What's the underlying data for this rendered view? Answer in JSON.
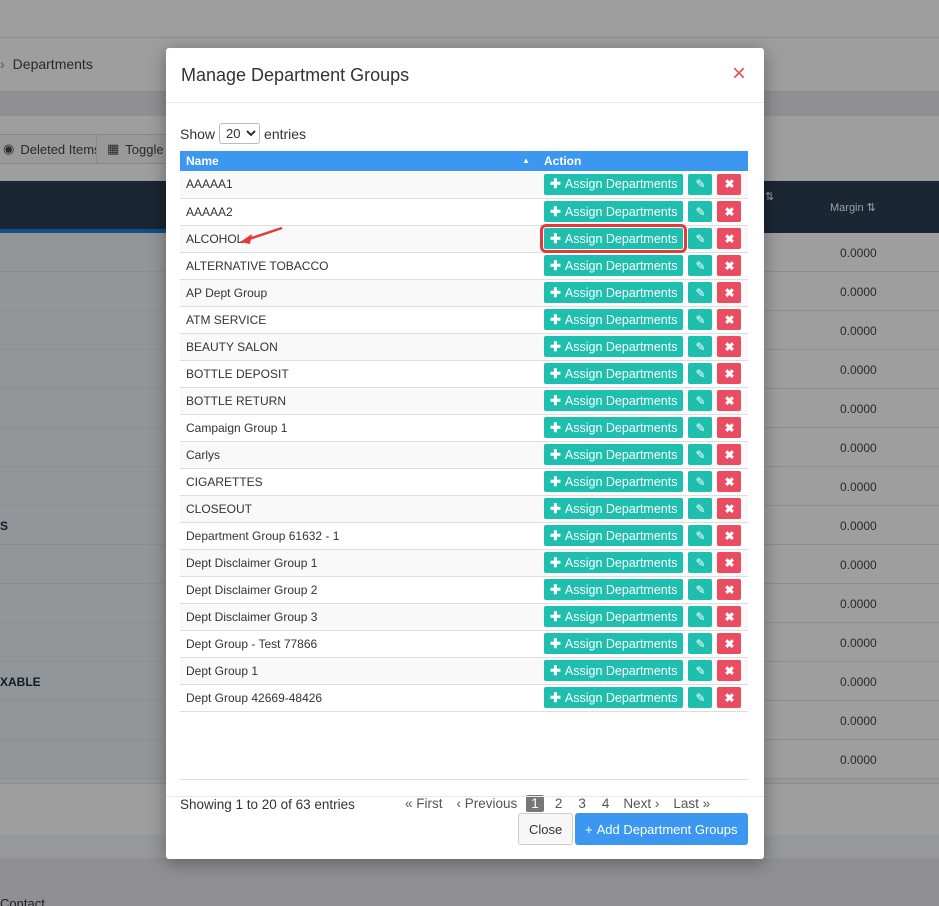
{
  "background": {
    "breadcrumb": "Departments",
    "toolbar": {
      "deleted_items": "Deleted Items",
      "toggle": "Toggle"
    },
    "margin_header": "Margin",
    "margin_value": "0.0000",
    "row_labels": [
      {
        "row": 7,
        "text": "S"
      },
      {
        "row": 11,
        "text": "XABLE"
      }
    ],
    "contact": "Contact"
  },
  "modal": {
    "title": "Manage Department Groups",
    "close_icon": "×",
    "length": {
      "prefix": "Show",
      "value": "20",
      "suffix": "entries"
    },
    "columns": {
      "name": "Name",
      "action": "Action"
    },
    "assign_label": "Assign Departments",
    "rows": [
      "AAAAA1",
      "AAAAA2",
      "ALCOHOL",
      "ALTERNATIVE TOBACCO",
      "AP Dept Group",
      "ATM SERVICE",
      "BEAUTY SALON",
      "BOTTLE DEPOSIT",
      "BOTTLE RETURN",
      "Campaign Group 1",
      "Carlys",
      "CIGARETTES",
      "CLOSEOUT",
      "Department Group 61632 - 1",
      "Dept Disclaimer Group 1",
      "Dept Disclaimer Group 2",
      "Dept Disclaimer Group 3",
      "Dept Group - Test 77866",
      "Dept Group 1",
      "Dept Group 42669-48426"
    ],
    "highlighted_row": 2,
    "info": "Showing 1 to 20 of 63 entries",
    "pagination": {
      "first": "« First",
      "previous": "‹ Previous",
      "pages": [
        "1",
        "2",
        "3",
        "4"
      ],
      "active": "1",
      "next": "Next ›",
      "last": "Last »"
    },
    "footer": {
      "close": "Close",
      "add": "Add Department Groups"
    }
  },
  "colors": {
    "primary": "#3b97f0",
    "teal": "#1ebfae",
    "danger": "#ea4c62",
    "highlight": "#e23b3b"
  }
}
